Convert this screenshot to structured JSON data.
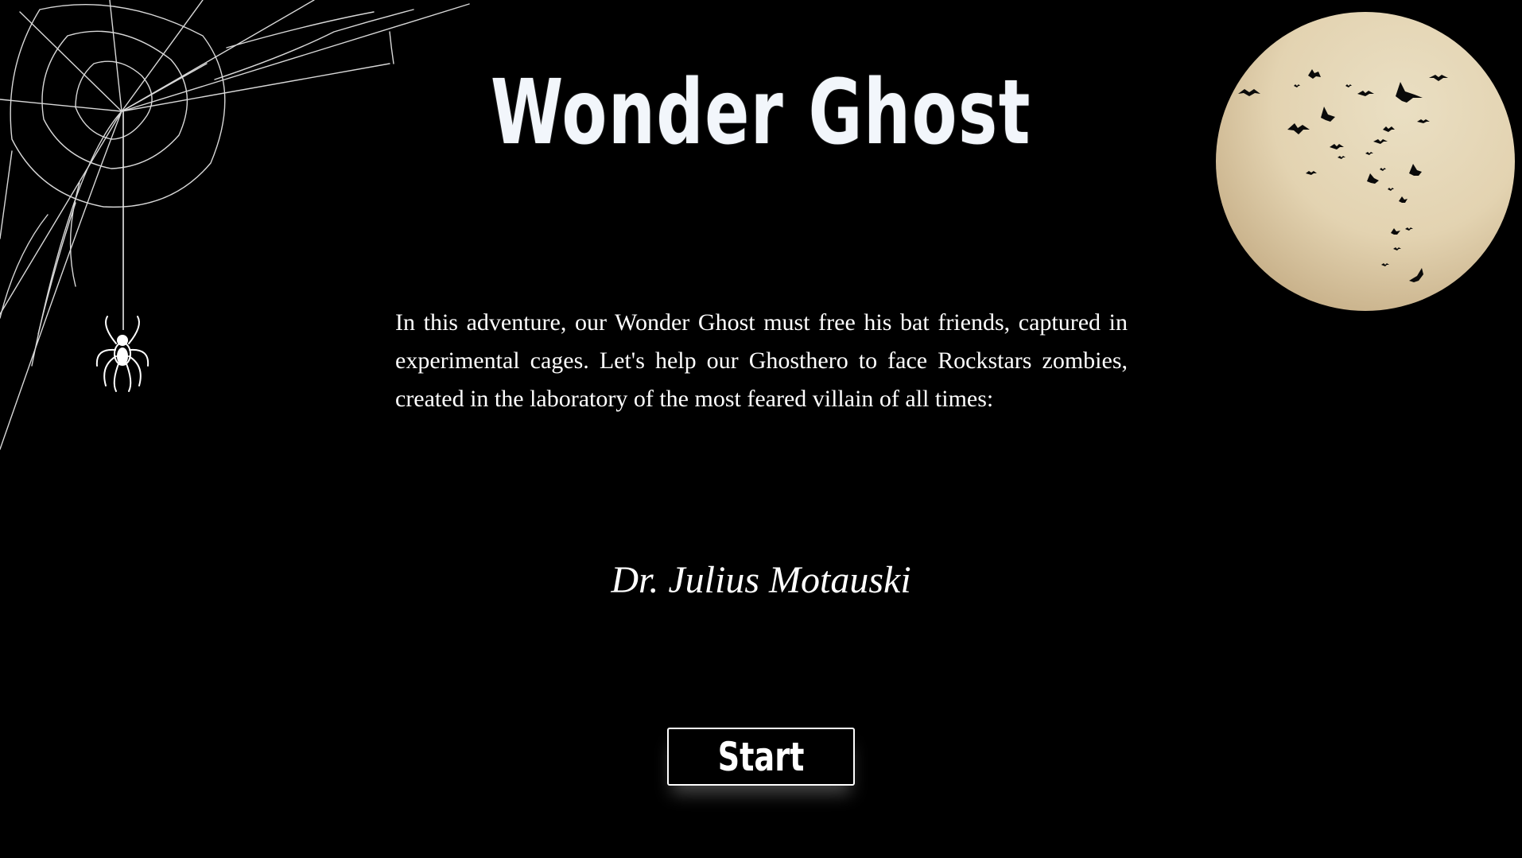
{
  "header": {
    "title": "Wonder Ghost"
  },
  "intro": {
    "text": "In this adventure, our Wonder Ghost must free his bat friends, captured in experimental cages. Let's help our Ghosthero to face Rockstars zombies, created in the laboratory of the most feared villain of all times:"
  },
  "villain": {
    "name": "Dr. Julius Motauski"
  },
  "actions": {
    "start_label": "Start"
  },
  "decorations": {
    "top_left": "cobweb-with-spider",
    "top_right": "full-moon-with-bats"
  },
  "colors": {
    "background": "#000000",
    "text": "#ffffff",
    "title": "#f2f6fb",
    "moon_light": "#e9dcbe",
    "moon_shade": "#cdb690",
    "bats": "#0a0a0a"
  }
}
